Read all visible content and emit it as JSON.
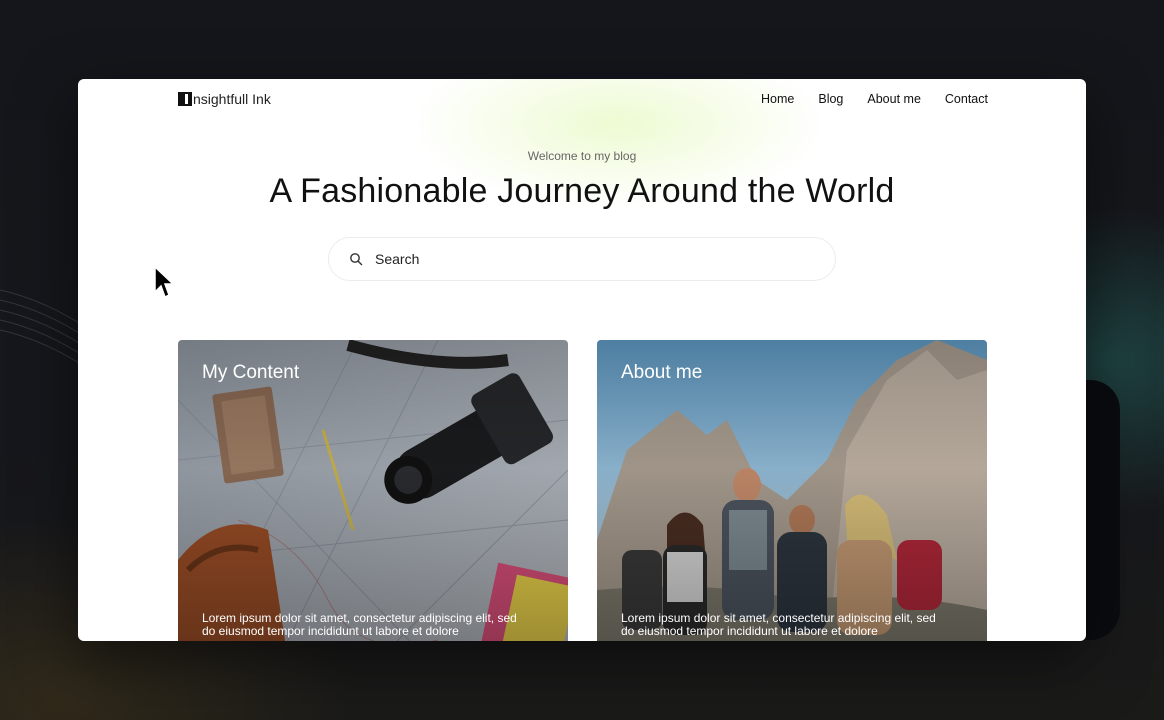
{
  "brand": {
    "name": "nsightfull Ink"
  },
  "nav": {
    "items": [
      "Home",
      "Blog",
      "About me",
      "Contact"
    ]
  },
  "hero": {
    "eyebrow": "Welcome to my blog",
    "title": "A Fashionable Journey Around the World"
  },
  "search": {
    "placeholder": "Search",
    "icon": "search-icon"
  },
  "cards": [
    {
      "title": "My Content",
      "text": "Lorem ipsum dolor sit amet, consectetur adipiscing elit, sed do eiusmod tempor incididunt ut labore et dolore",
      "image": "travel-flatlay-camera-map"
    },
    {
      "title": "About me",
      "text": "Lorem ipsum dolor sit amet, consectetur adipiscing elit, sed do eiusmod tempor incididunt ut labore et dolore",
      "image": "friends-hiking-mountains"
    }
  ],
  "colors": {
    "background": "#14161c",
    "window": "#ffffff",
    "text": "#111111",
    "muted": "#666666",
    "glow": "#ebfacd"
  }
}
